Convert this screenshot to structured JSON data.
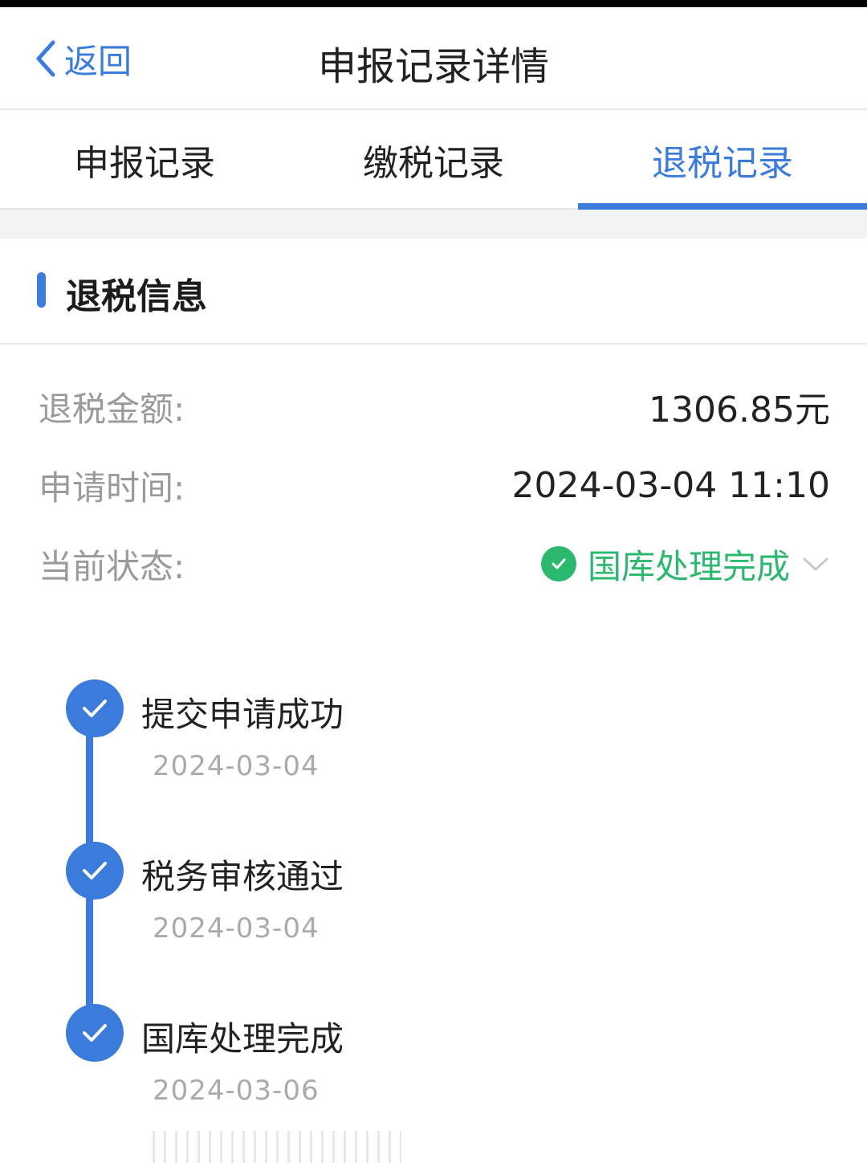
{
  "header": {
    "back_label": "返回",
    "title": "申报记录详情"
  },
  "tabs": [
    {
      "label": "申报记录",
      "active": false
    },
    {
      "label": "缴税记录",
      "active": false
    },
    {
      "label": "退税记录",
      "active": true
    }
  ],
  "section": {
    "title": "退税信息"
  },
  "info": {
    "amount_label": "退税金额:",
    "amount_value": "1306.85元",
    "time_label": "申请时间:",
    "time_value": "2024-03-04 11:10",
    "status_label": "当前状态:",
    "status_value": "国库处理完成"
  },
  "timeline": [
    {
      "title": "提交申请成功",
      "date": "2024-03-04"
    },
    {
      "title": "税务审核通过",
      "date": "2024-03-04"
    },
    {
      "title": "国库处理完成",
      "date": "2024-03-06"
    }
  ],
  "colors": {
    "accent": "#3a7bdc",
    "success": "#2db86f",
    "label_gray": "#9a9a9a"
  },
  "icons": {
    "back": "chevron-left-icon",
    "status": "check-circle-icon",
    "expand": "chevron-down-icon",
    "step": "check-icon"
  }
}
